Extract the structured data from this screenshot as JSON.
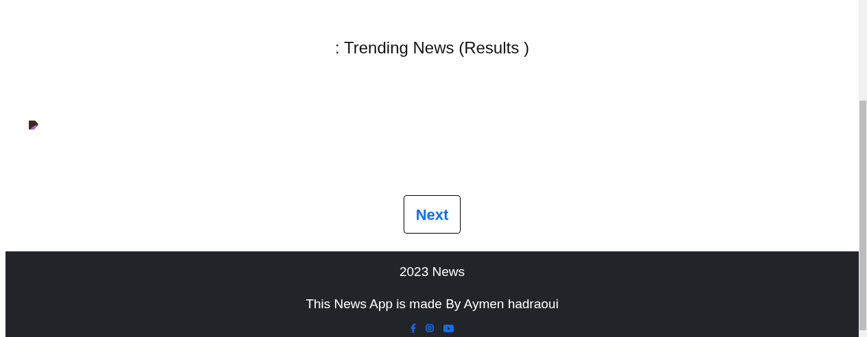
{
  "heading": ": Trending News (Results )",
  "next_button": {
    "label": "Next"
  },
  "footer": {
    "year_text": "2023 News",
    "credit": "This News App is made By Aymen hadraoui"
  }
}
